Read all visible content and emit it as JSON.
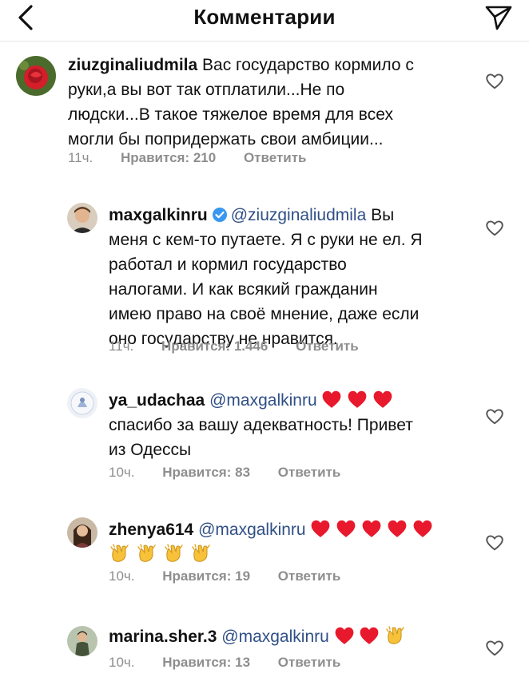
{
  "header": {
    "title": "Комментарии"
  },
  "comments": [
    {
      "username": "ziuzginaliudmila",
      "mention": "",
      "text_line1": " Вас государство кормило с",
      "text_rest": [
        "руки,а вы вот так отплатили...Не по",
        "людски...В такое тяжелое время для всех",
        "могли бы попридержать свои амбиции..."
      ],
      "time": "11ч.",
      "likes": "Нравится: 210",
      "reply": "Ответить",
      "verified": false
    },
    {
      "username": "maxgalkinru",
      "mention": "@ziuzginaliudmila",
      "text_line1": " Вы",
      "text_rest": [
        "меня с кем-то путаете. Я с руки не ел. Я",
        "работал и кормил государство",
        "налогами. И как всякий гражданин",
        "имею право на своё мнение, даже если",
        "оно государству не нравится."
      ],
      "time": "11ч.",
      "likes": "Нравится: 1.446",
      "reply": "Ответить",
      "verified": true
    },
    {
      "username": "ya_udachaa",
      "mention": "@maxgalkinru",
      "text_line1": "",
      "text_rest": [
        "спасибо за вашу адекватность! Привет",
        "из Одессы"
      ],
      "time": "10ч.",
      "likes": "Нравится: 83",
      "reply": "Ответить",
      "emoji_line1": [
        "red-heart",
        "red-heart",
        "red-heart"
      ]
    },
    {
      "username": "zhenya614",
      "mention": "@maxgalkinru",
      "text_line1": "",
      "text_rest": [],
      "time": "10ч.",
      "likes": "Нравится: 19",
      "reply": "Ответить",
      "emoji_line1": [
        "red-heart",
        "red-heart",
        "red-heart",
        "red-heart",
        "red-heart"
      ],
      "emoji_line2": [
        "clapping-hands",
        "clapping-hands",
        "clapping-hands",
        "clapping-hands"
      ]
    },
    {
      "username": "marina.sher.3",
      "mention": "@maxgalkinru",
      "text_line1": "",
      "text_rest": [],
      "time": "10ч.",
      "likes": "Нравится: 13",
      "reply": "Ответить",
      "emoji_line1": [
        "red-heart",
        "red-heart",
        "clapping-hands"
      ]
    }
  ],
  "colors": {
    "mention": "#2f4f86",
    "meta": "#8e8e8e",
    "heart": "#e8192c",
    "verified": "#3897f0"
  }
}
